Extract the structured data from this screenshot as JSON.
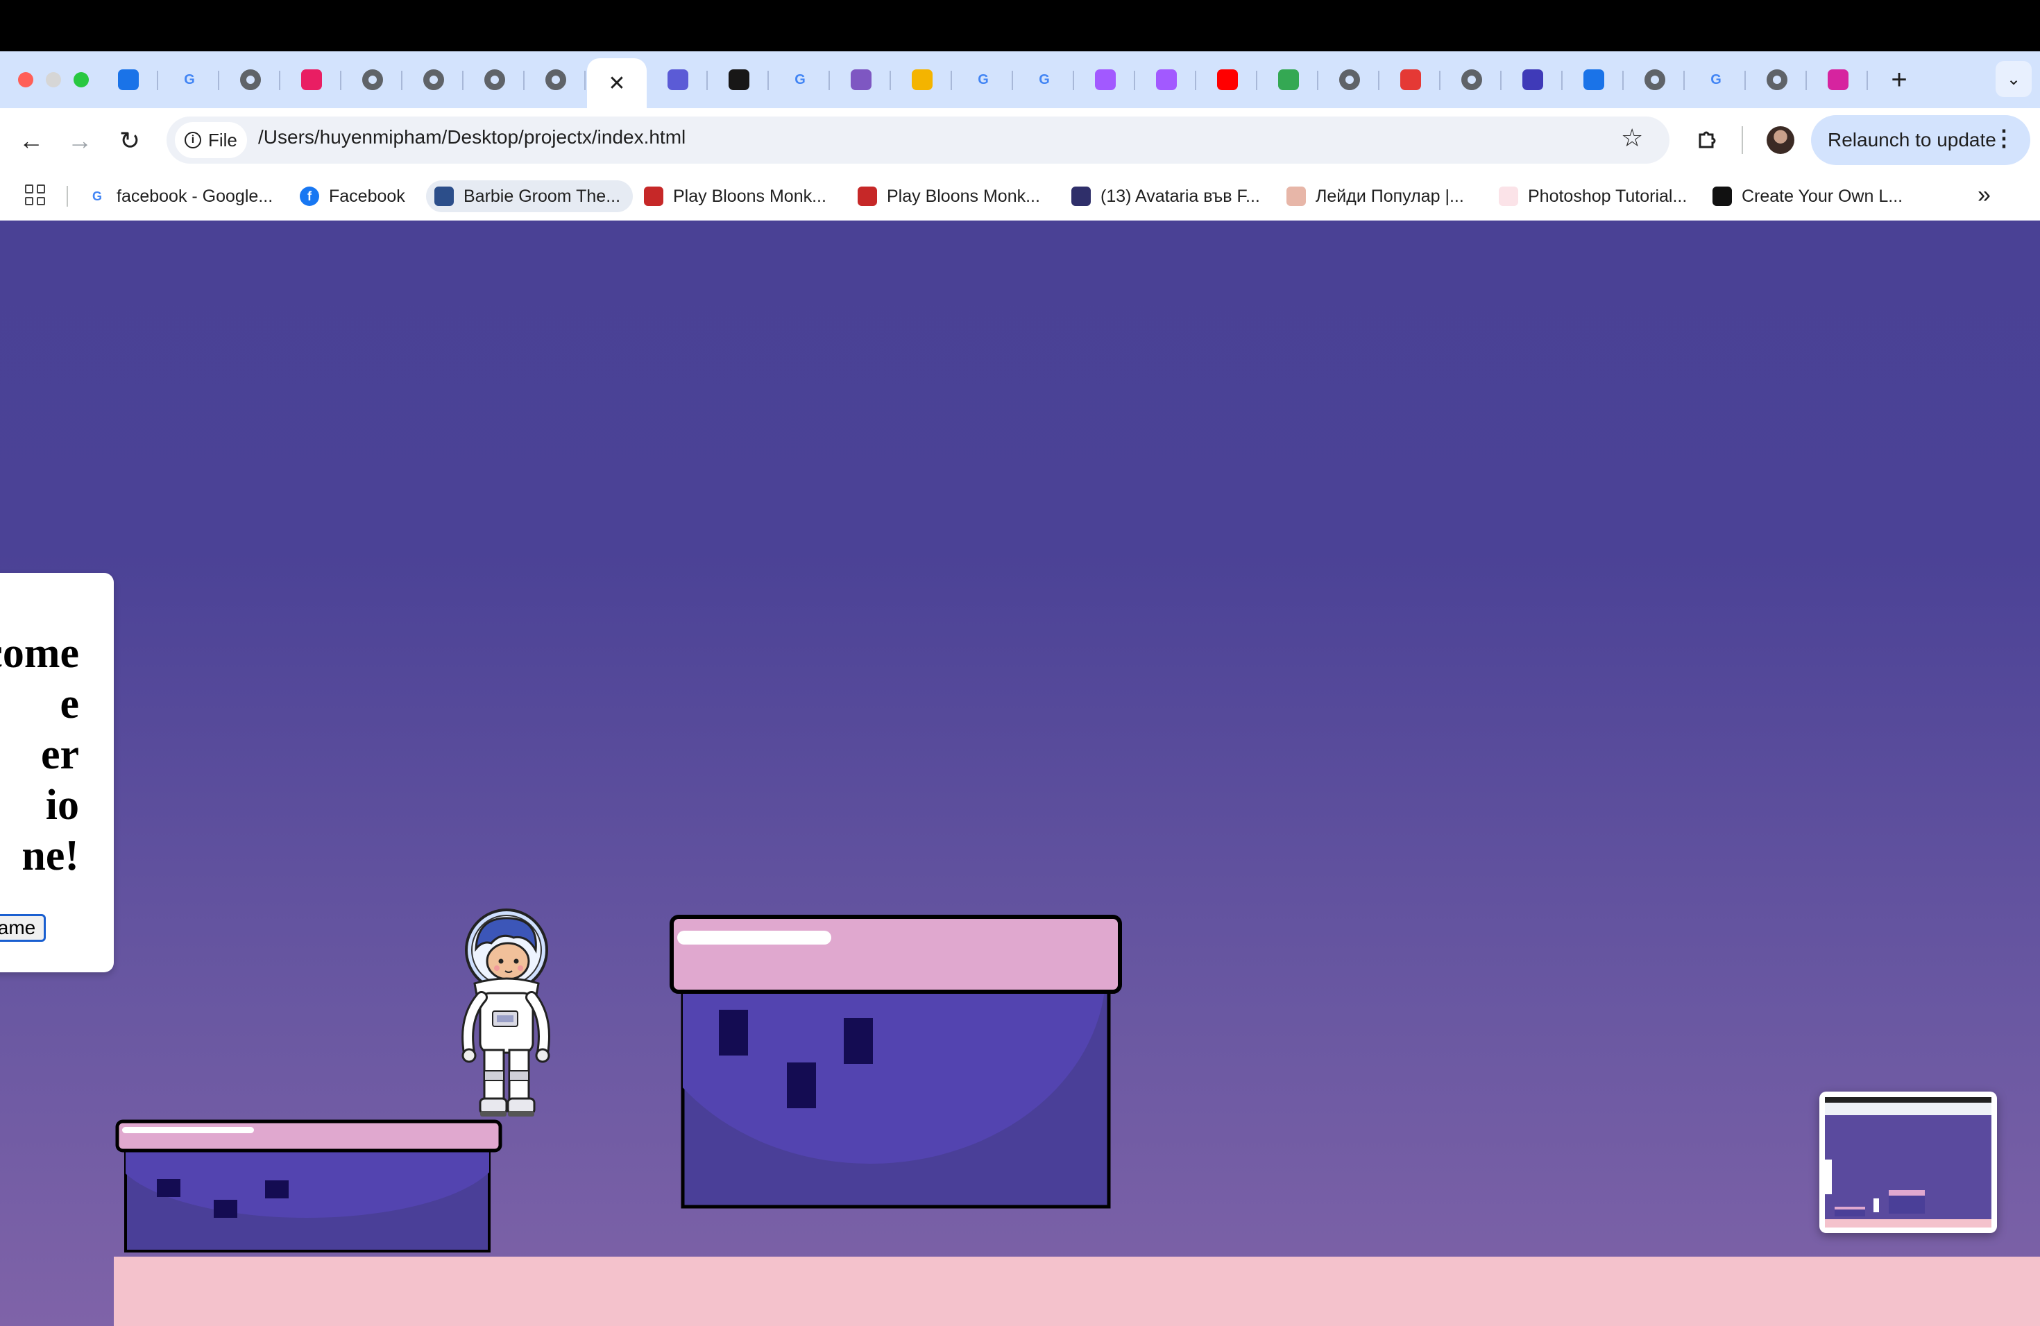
{
  "browser": {
    "tabs": [
      {
        "icon": "chrome-icon"
      },
      {
        "icon": "google-icon"
      },
      {
        "icon": "globe-icon"
      },
      {
        "icon": "app-icon"
      },
      {
        "icon": "globe-icon"
      },
      {
        "icon": "globe-icon"
      },
      {
        "icon": "globe-icon"
      },
      {
        "icon": "globe-icon"
      },
      {
        "icon": "close-icon",
        "active": true
      },
      {
        "icon": "calendar-icon"
      },
      {
        "icon": "github-icon"
      },
      {
        "icon": "google-icon"
      },
      {
        "icon": "cube-icon"
      },
      {
        "icon": "classroom-icon"
      },
      {
        "icon": "google-icon"
      },
      {
        "icon": "google-icon"
      },
      {
        "icon": "figma-icon"
      },
      {
        "icon": "figma-icon"
      },
      {
        "icon": "youtube-icon"
      },
      {
        "icon": "drive-icon"
      },
      {
        "icon": "globe-icon"
      },
      {
        "icon": "target-icon"
      },
      {
        "icon": "globe-icon"
      },
      {
        "icon": "list-icon"
      },
      {
        "icon": "chrome-icon"
      },
      {
        "icon": "globe-icon"
      },
      {
        "icon": "google-icon"
      },
      {
        "icon": "globe-icon"
      },
      {
        "icon": "instagram-icon"
      }
    ],
    "new_tab_glyph": "+",
    "tab_menu_glyph": "⌄",
    "toolbar": {
      "back": "←",
      "forward": "→",
      "reload": "↻",
      "chip_label": "File",
      "url": "/Users/huyenmipham/Desktop/projectx/index.html",
      "relaunch_label": "Relaunch to update"
    },
    "bookmarks": [
      {
        "label": "facebook - Google...",
        "icon": "google-icon"
      },
      {
        "label": "Facebook",
        "icon": "facebook-icon"
      },
      {
        "label": "Barbie Groom The...",
        "icon": "target-icon"
      },
      {
        "label": "Play Bloons Monk...",
        "icon": "bloons-icon"
      },
      {
        "label": "Play Bloons Monk...",
        "icon": "bloons-icon"
      },
      {
        "label": "(13) Avataria във F...",
        "icon": "avataria-icon"
      },
      {
        "label": "Лейди Популар |...",
        "icon": "lady-icon"
      },
      {
        "label": "Photoshop Tutorial...",
        "icon": "photoshop-icon"
      },
      {
        "label": "Create Your Own L...",
        "icon": "logo-icon"
      }
    ],
    "more_glyph": "»"
  },
  "game": {
    "welcome_lines": [
      "come",
      "e",
      "er",
      "io",
      "ne!"
    ],
    "start_button_label": "Game",
    "colors": {
      "sky_top": "#4a4195",
      "sky_bottom": "#7f63a8",
      "platform_top": "#e0a8cf",
      "platform_body": "#4f43aa",
      "window": "#140c52",
      "ground": "#f4c2cc"
    }
  }
}
